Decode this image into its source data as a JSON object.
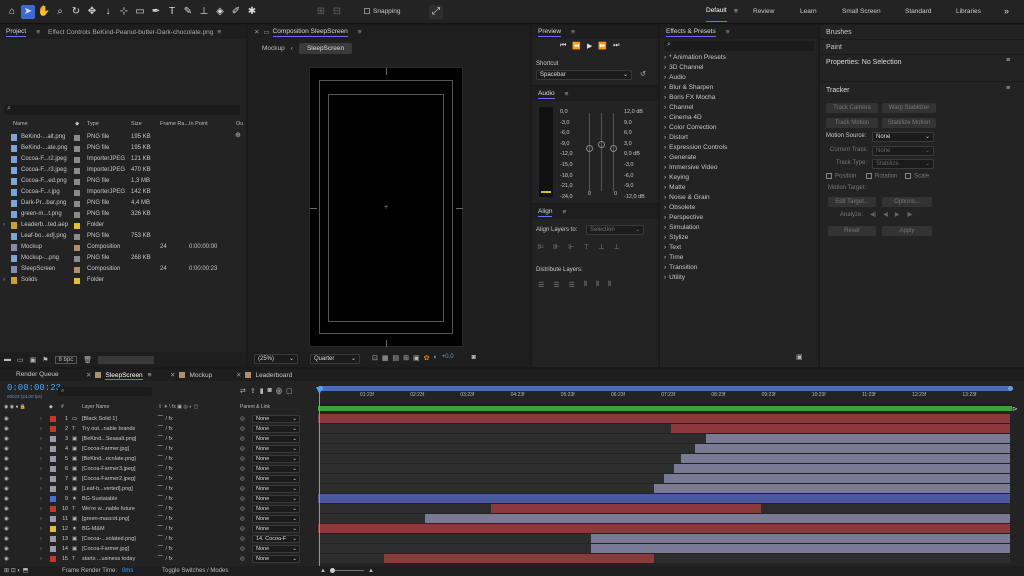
{
  "toolbar": {
    "tools": [
      {
        "name": "home-icon",
        "glyph": "⌂",
        "selected": false
      },
      {
        "name": "selection-tool-icon",
        "glyph": "➤",
        "selected": true
      },
      {
        "name": "hand-tool-icon",
        "glyph": "✋",
        "selected": false
      },
      {
        "name": "zoom-tool-icon",
        "glyph": "⌕",
        "selected": false
      },
      {
        "name": "rotate-tool-icon",
        "glyph": "↻",
        "selected": false
      },
      {
        "name": "camera-tool-icon",
        "glyph": "✥",
        "selected": false
      },
      {
        "name": "pan-behind-tool-icon",
        "glyph": "↓",
        "selected": false
      },
      {
        "name": "anchor-tool-icon",
        "glyph": "⊹",
        "selected": false
      },
      {
        "name": "rectangle-tool-icon",
        "glyph": "▭",
        "selected": false
      },
      {
        "name": "pen-tool-icon",
        "glyph": "✒",
        "selected": false
      },
      {
        "name": "type-tool-icon",
        "glyph": "T",
        "selected": false
      },
      {
        "name": "brush-tool-icon",
        "glyph": "✎",
        "selected": false
      },
      {
        "name": "clone-stamp-tool-icon",
        "glyph": "⊥",
        "selected": false
      },
      {
        "name": "eraser-tool-icon",
        "glyph": "◈",
        "selected": false
      },
      {
        "name": "roto-brush-tool-icon",
        "glyph": "✐",
        "selected": false
      },
      {
        "name": "puppet-tool-icon",
        "glyph": "✱",
        "selected": false
      }
    ],
    "snapping_label": "Snapping"
  },
  "workspaces": [
    "Default",
    "Review",
    "Learn",
    "Small Screen",
    "Standard",
    "Libraries"
  ],
  "project": {
    "tab_label": "Project",
    "effect_controls_label": "Effect Controls BeKind-Peanut-butter-Dark-chocolate.png",
    "search_placeholder": "",
    "columns": [
      "Name",
      "Type",
      "Size",
      "Frame Ra...",
      "In Point"
    ],
    "items": [
      {
        "name": "BeKind-...alt.png",
        "type": "PNG file",
        "size": "195 KB",
        "fr": "",
        "in": "",
        "color": "#8a8a8a",
        "icon": "file"
      },
      {
        "name": "BeKind-...ate.png",
        "type": "PNG file",
        "size": "195 KB",
        "fr": "",
        "in": "",
        "color": "#8a8a8a",
        "icon": "file"
      },
      {
        "name": "Cocoa-F...r2.jpeg",
        "type": "ImporterJPEG",
        "size": "121 KB",
        "fr": "",
        "in": "",
        "color": "#8a8a8a",
        "icon": "file"
      },
      {
        "name": "Cocoa-F...r3.jpeg",
        "type": "ImporterJPEG",
        "size": "470 KB",
        "fr": "",
        "in": "",
        "color": "#8a8a8a",
        "icon": "file"
      },
      {
        "name": "Cocoa-F...ed.png",
        "type": "PNG file",
        "size": "1,3 MB",
        "fr": "",
        "in": "",
        "color": "#8a8a8a",
        "icon": "file"
      },
      {
        "name": "Cocoa-F...r.jpg",
        "type": "ImporterJPEG",
        "size": "142 KB",
        "fr": "",
        "in": "",
        "color": "#8a8a8a",
        "icon": "file"
      },
      {
        "name": "Dark-Pr...bar.png",
        "type": "PNG file",
        "size": "4,4 MB",
        "fr": "",
        "in": "",
        "color": "#8a8a8a",
        "icon": "file"
      },
      {
        "name": "green-m...t.png",
        "type": "PNG file",
        "size": "326 KB",
        "fr": "",
        "in": "",
        "color": "#8a8a8a",
        "icon": "file"
      },
      {
        "name": "Leaderb...ted.aep",
        "type": "Folder",
        "size": "",
        "fr": "",
        "in": "",
        "color": "#e0c030",
        "icon": "folder"
      },
      {
        "name": "Leaf-bo...ed].png",
        "type": "PNG file",
        "size": "753 KB",
        "fr": "",
        "in": "",
        "color": "#8a8a8a",
        "icon": "file"
      },
      {
        "name": "Mockup",
        "type": "Composition",
        "size": "",
        "fr": "24",
        "in": "0:00:00:00",
        "color": "#b08f6a",
        "icon": "comp"
      },
      {
        "name": "Mockup-...png",
        "type": "PNG file",
        "size": "268 KB",
        "fr": "",
        "in": "",
        "color": "#8a8a8a",
        "icon": "file"
      },
      {
        "name": "SleepScreen",
        "type": "Composition",
        "size": "",
        "fr": "24",
        "in": "0:00:00:23",
        "color": "#b08f6a",
        "icon": "comp"
      },
      {
        "name": "Solids",
        "type": "Folder",
        "size": "",
        "fr": "",
        "in": "",
        "color": "#e0c030",
        "icon": "folder"
      }
    ],
    "bpc": "8 bpc"
  },
  "composition": {
    "tab_label": "Composition SleepScreen",
    "breadcrumbs": [
      "Mockup",
      "SleepScreen"
    ],
    "zoom": "(25%)",
    "resolution": "Quarter",
    "exposure": "+0,0"
  },
  "preview": {
    "tab_label": "Preview",
    "shortcut_label": "Shortcut",
    "shortcut_value": "Spacebar"
  },
  "audio": {
    "tab_label": "Audio",
    "left_scale": [
      "0,0",
      "-3,0",
      "-6,0",
      "-9,0",
      "-12,0",
      "-15,0",
      "-18,0",
      "-21,0",
      "-24,0"
    ],
    "right_scale": [
      "12,0 dB",
      "9,0",
      "6,0",
      "3,0",
      "0,0 dB",
      "-3,0",
      "-6,0",
      "-9,0",
      "-12,0 dB"
    ],
    "zeros": [
      "0",
      "0"
    ]
  },
  "align": {
    "tab_label": "Align",
    "align_to_label": "Align Layers to:",
    "align_to_value": "Selection",
    "distribute_label": "Distribute Layers:"
  },
  "effects": {
    "tab_label": "Effects & Presets",
    "categories": [
      "* Animation Presets",
      "3D Channel",
      "Audio",
      "Blur & Sharpen",
      "Boris FX Mocha",
      "Channel",
      "Cinema 4D",
      "Color Correction",
      "Distort",
      "Expression Controls",
      "Generate",
      "Immersive Video",
      "Keying",
      "Matte",
      "Noise & Grain",
      "Obsolete",
      "Perspective",
      "Simulation",
      "Stylize",
      "Text",
      "Time",
      "Transition",
      "Utility"
    ]
  },
  "right": {
    "brushes": "Brushes",
    "paint": "Paint",
    "properties": "Properties: No Selection",
    "tracker": "Tracker",
    "track_camera": "Track Camera",
    "warp_stabilizer": "Warp Stabilizer",
    "track_motion": "Track Motion",
    "stabilize_motion": "Stabilize Motion",
    "motion_source_label": "Motion Source:",
    "motion_source_value": "None",
    "current_track_label": "Current Track:",
    "current_track_value": "None",
    "track_type_label": "Track Type:",
    "track_type_value": "Stabilize",
    "position": "Position",
    "rotation": "Rotation",
    "scale": "Scale",
    "motion_target": "Motion Target:",
    "edit_target": "Edit Target...",
    "options": "Options...",
    "analyze": "Analyze:",
    "reset": "Reset",
    "apply": "Apply"
  },
  "timeline": {
    "tabs": [
      "Render Queue",
      "SleepScreen",
      "Mockup",
      "Leaderboard"
    ],
    "timecode": "0:00:00:23",
    "fps": "00023 (24.00 fps)",
    "col_layer_name": "Layer Name",
    "col_parent": "Parent & Link",
    "ruler": [
      "01:23f",
      "02:23f",
      "03:23f",
      "04:23f",
      "05:23f",
      "06:23f",
      "07:23f",
      "08:23f",
      "09:23f",
      "10:23f",
      "11:23f",
      "12:23f",
      "13:23f"
    ],
    "layers": [
      {
        "num": "1",
        "type": "▭",
        "name": "[Black Solid 1]",
        "color": "#c0392b",
        "parent": "None",
        "bar_start": 0.0,
        "bar_color": "#8a3a3a"
      },
      {
        "num": "2",
        "type": "T",
        "name": "Try out...nable brands",
        "color": "#c0392b",
        "parent": "None",
        "bar_start": 0.51,
        "bar_color": "#8a3a3a"
      },
      {
        "num": "3",
        "type": "▣",
        "name": "[BeKind...Seasalt.png]",
        "color": "#9a9aa8",
        "parent": "None",
        "bar_start": 0.56,
        "bar_color": "#7a7a94"
      },
      {
        "num": "4",
        "type": "▣",
        "name": "[Cocoa-Farmer.jpg]",
        "color": "#9a9aa8",
        "parent": "None",
        "bar_start": 0.545,
        "bar_color": "#7a7a94"
      },
      {
        "num": "5",
        "type": "▣",
        "name": "[BeKind...ocolate.png]",
        "color": "#9a9aa8",
        "parent": "None",
        "bar_start": 0.525,
        "bar_color": "#7a7a94"
      },
      {
        "num": "6",
        "type": "▣",
        "name": "[Cocoa-Farmer3.jpeg]",
        "color": "#9a9aa8",
        "parent": "None",
        "bar_start": 0.515,
        "bar_color": "#7a7a94"
      },
      {
        "num": "7",
        "type": "▣",
        "name": "[Cocoa-Farmer2.jpeg]",
        "color": "#9a9aa8",
        "parent": "None",
        "bar_start": 0.5,
        "bar_color": "#7a7a94"
      },
      {
        "num": "8",
        "type": "▣",
        "name": "[Leaf-b...verted].png]",
        "color": "#9a9aa8",
        "parent": "None",
        "bar_start": 0.485,
        "bar_color": "#7a7a94"
      },
      {
        "num": "9",
        "type": "★",
        "name": "BG-Sustaiable",
        "color": "#4d6bd1",
        "parent": "None",
        "bar_start": 0.0,
        "bar_color": "#4b5a9e"
      },
      {
        "num": "10",
        "type": "T",
        "name": "We're w...nable future",
        "color": "#c0392b",
        "parent": "None",
        "bar_start": 0.25,
        "bar_end": 0.64,
        "bar_color": "#8a3a3a"
      },
      {
        "num": "11",
        "type": "▣",
        "name": "[green-mascot.png]",
        "color": "#9a9aa8",
        "parent": "None",
        "bar_start": 0.155,
        "bar_color": "#7a7a94"
      },
      {
        "num": "12",
        "type": "★",
        "name": "BG-M&M",
        "color": "#e0c030",
        "parent": "None",
        "bar_start": 0.0,
        "bar_color": "#8a3a3a"
      },
      {
        "num": "13",
        "type": "▣",
        "name": "[Cocoa-...solated.png]",
        "color": "#9a9aa8",
        "parent": "14. Cocoa-F",
        "bar_start": 0.395,
        "bar_color": "#7a7a94"
      },
      {
        "num": "14",
        "type": "▣",
        "name": "[Cocoa-Farmer.jpg]",
        "color": "#9a9aa8",
        "parent": "None",
        "bar_start": 0.395,
        "bar_color": "#7a7a94"
      },
      {
        "num": "15",
        "type": "T",
        "name": "starts ...usiness today",
        "color": "#c0392b",
        "parent": "None",
        "bar_start": 0.095,
        "bar_end": 0.485,
        "bar_color": "#8a3a3a"
      }
    ],
    "frame_render_label": "Frame Render Time:",
    "frame_render_value": "0ms",
    "toggle_label": "Toggle Switches / Modes"
  }
}
